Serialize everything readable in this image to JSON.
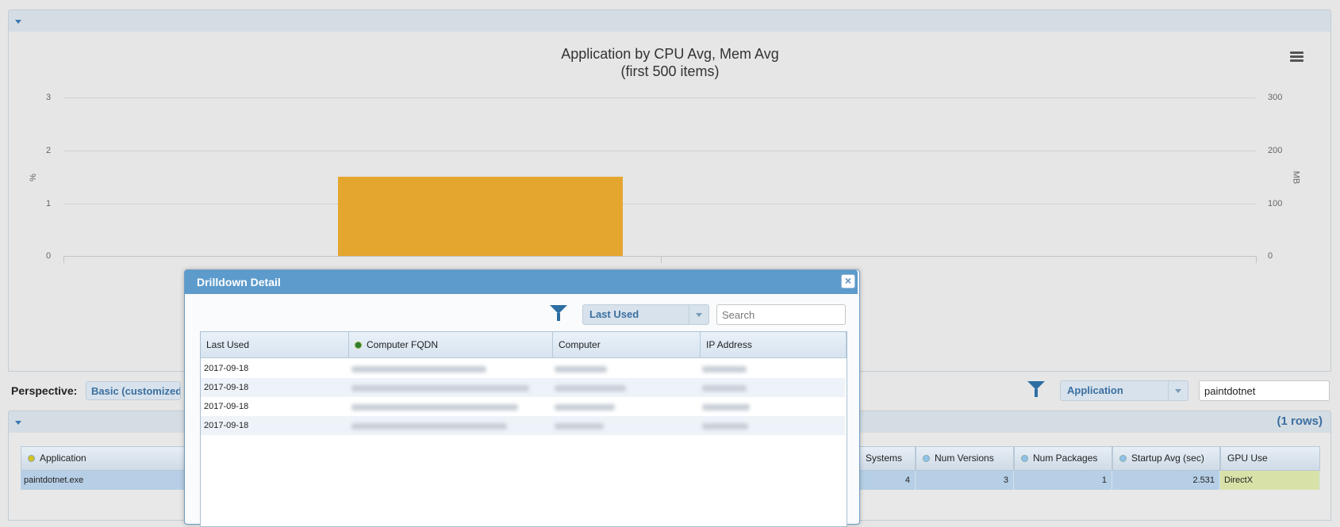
{
  "chart_data": {
    "type": "bar",
    "title": "Application by CPU Avg, Mem Avg",
    "subtitle": "(first 500 items)",
    "ylabel": "%",
    "y2label": "MB",
    "ylim": [
      0,
      3
    ],
    "y2lim": [
      0,
      300
    ],
    "yticks": [
      "0",
      "1",
      "2",
      "3"
    ],
    "y2ticks": [
      "0",
      "100",
      "200",
      "300"
    ],
    "categories": [
      "paintdotnet.exe"
    ],
    "series": [
      {
        "axis": "y",
        "values": [
          1.5
        ],
        "color": "#e5a630"
      }
    ]
  },
  "perspective": {
    "label": "Perspective:",
    "value": "Basic (customized)"
  },
  "filter": {
    "field": "Application",
    "value": "paintdotnet"
  },
  "grid": {
    "rows_count": "(1 rows)",
    "columns": [
      {
        "label": "Application",
        "dot": "#d4c21f"
      },
      {
        "label": "Systems",
        "dot": ""
      },
      {
        "label": "Num Versions",
        "dot": "#8fc3e8"
      },
      {
        "label": "Num Packages",
        "dot": "#8fc3e8"
      },
      {
        "label": "Startup Avg (sec)",
        "dot": "#8fc3e8"
      },
      {
        "label": "GPU Use",
        "dot": ""
      }
    ],
    "row": {
      "application": "paintdotnet.exe",
      "systems": "4",
      "num_versions": "3",
      "num_packages": "1",
      "startup_avg": "2.531",
      "gpu_use": "DirectX"
    }
  },
  "modal": {
    "title": "Drilldown Detail",
    "close": "×",
    "sort_field": "Last Used",
    "search_placeholder": "Search",
    "columns": [
      "Last Used",
      "Computer FQDN",
      "Computer",
      "IP Address"
    ],
    "fqdn_dot": "#2e7d32",
    "rows": [
      {
        "last_used": "2017-09-18"
      },
      {
        "last_used": "2017-09-18"
      },
      {
        "last_used": "2017-09-18"
      },
      {
        "last_used": "2017-09-18"
      }
    ]
  }
}
